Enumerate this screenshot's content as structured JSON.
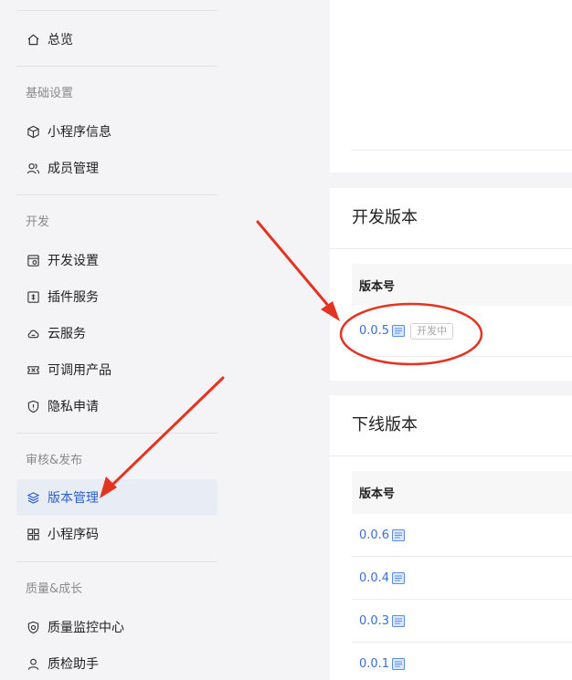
{
  "sidebar": {
    "overview": {
      "label": "总览",
      "icon": "home-icon"
    },
    "sections": [
      {
        "title": "基础设置",
        "items": [
          {
            "label": "小程序信息",
            "icon": "cube-icon"
          },
          {
            "label": "成员管理",
            "icon": "members-icon"
          }
        ]
      },
      {
        "title": "开发",
        "items": [
          {
            "label": "开发设置",
            "icon": "dev-settings-icon"
          },
          {
            "label": "插件服务",
            "icon": "plugin-icon"
          },
          {
            "label": "云服务",
            "icon": "cloud-icon"
          },
          {
            "label": "可调用产品",
            "icon": "ticket-icon"
          },
          {
            "label": "隐私申请",
            "icon": "shield-icon"
          }
        ]
      },
      {
        "title": "审核&发布",
        "items": [
          {
            "label": "版本管理",
            "icon": "layers-icon",
            "active": true
          },
          {
            "label": "小程序码",
            "icon": "grid-icon"
          }
        ]
      },
      {
        "title": "质量&成长",
        "items": [
          {
            "label": "质量监控中心",
            "icon": "quality-shield-icon"
          },
          {
            "label": "质检助手",
            "icon": "user-icon"
          }
        ]
      }
    ]
  },
  "dev_version": {
    "title": "开发版本",
    "column_header": "版本号",
    "rows": [
      {
        "version": "0.0.5",
        "badge": "开发中"
      }
    ]
  },
  "offline_version": {
    "title": "下线版本",
    "column_header": "版本号",
    "rows": [
      {
        "version": "0.0.6"
      },
      {
        "version": "0.0.4"
      },
      {
        "version": "0.0.3"
      },
      {
        "version": "0.0.1"
      }
    ]
  },
  "colors": {
    "accent": "#2a5fcf",
    "link": "#3b6fd4",
    "annotation": "#e53322",
    "active_bg": "#e8ecf5"
  }
}
